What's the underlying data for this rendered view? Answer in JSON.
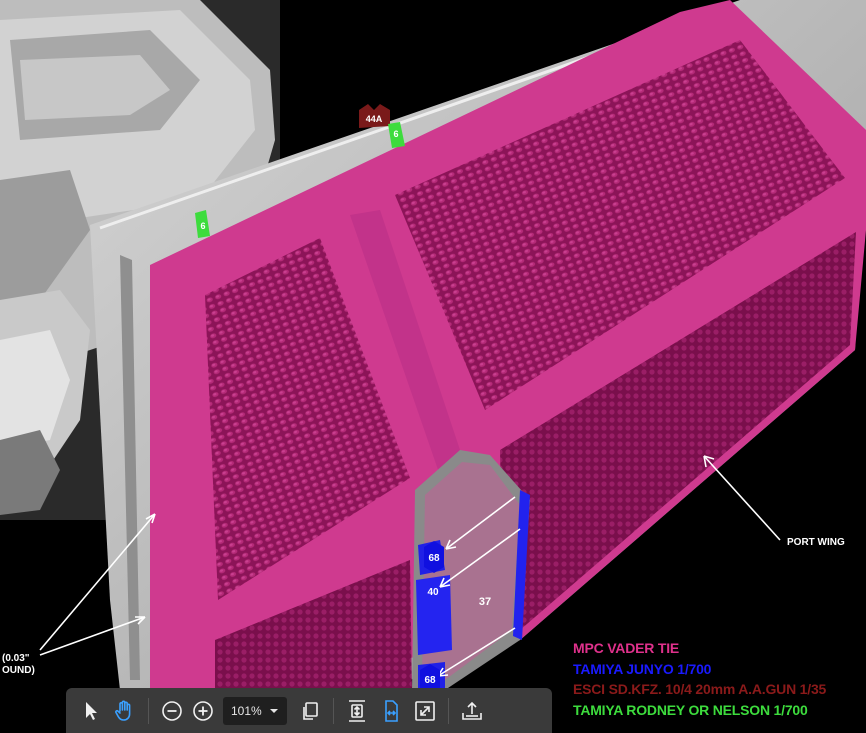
{
  "callouts": {
    "badge_44a": "44A",
    "badge_6_top": "6",
    "badge_6_left": "6",
    "badge_68_top": "68",
    "badge_40": "40",
    "badge_37": "37",
    "badge_68_bottom": "68",
    "port_wing": "PORT WING",
    "left_cut_line1": "(0.03\"",
    "left_cut_line2": "OUND)"
  },
  "legend": {
    "items": [
      {
        "label": "MPC VADER TIE",
        "color": "#e0318c"
      },
      {
        "label": "TAMIYA JUNYO 1/700",
        "color": "#1a1aff"
      },
      {
        "label": "ESCI SD.KFZ. 10/4 20mm A.A.GUN 1/35",
        "color": "#8b1a1a"
      },
      {
        "label": "TAMIYA RODNEY OR NELSON 1/700",
        "color": "#3ddc3d"
      }
    ]
  },
  "toolbar": {
    "zoom_value": "101%"
  },
  "icons": {
    "select": "cursor-arrow-icon",
    "hand": "hand-pan-icon",
    "zoom_out": "zoom-out-icon",
    "zoom_in": "zoom-in-icon",
    "dropdown": "chevron-down-icon",
    "pages": "copy-pages-icon",
    "fit_page": "fit-page-icon",
    "fit_width": "fit-width-icon",
    "fullscreen": "fullscreen-icon",
    "export": "upload-export-icon"
  }
}
